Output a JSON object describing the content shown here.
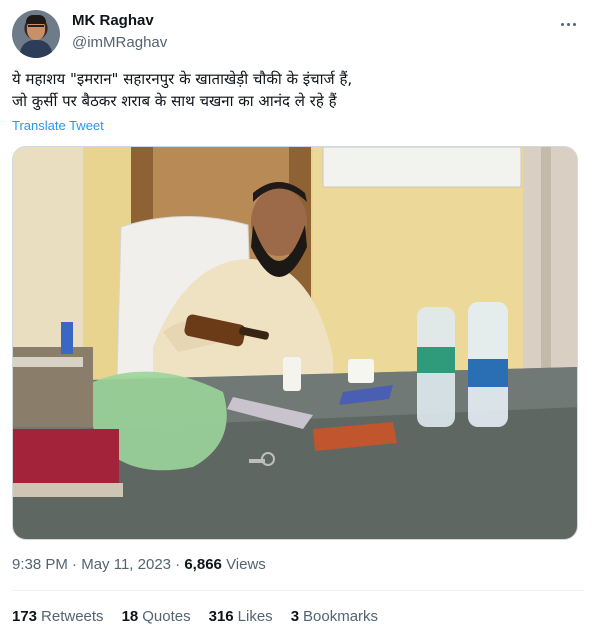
{
  "author": {
    "name": "MK Raghav",
    "handle": "@imMRaghav"
  },
  "icons": {
    "more": "more-horizontal-icon"
  },
  "tweet": {
    "line1": "ये महाशय \"इमरान\" सहारनपुर के खाताखेड़ी चौकी के इंचार्ज हैं,",
    "line2": "जो कुर्सी पर बैठकर शराब के साथ चखना  का आनंद ले रहे हैं",
    "translate_label": "Translate Tweet"
  },
  "meta": {
    "time": "9:38 PM",
    "separator1": " · ",
    "date": "May 11, 2023",
    "separator2": " · ",
    "views_count": "6,866",
    "views_label": "Views"
  },
  "stats": [
    {
      "count": "173",
      "label": "Retweets"
    },
    {
      "count": "18",
      "label": "Quotes"
    },
    {
      "count": "316",
      "label": "Likes"
    },
    {
      "count": "3",
      "label": "Bookmarks"
    }
  ],
  "colors": {
    "link": "#1d9bf0",
    "secondary_text": "#536471",
    "primary_text": "#0f1419"
  }
}
